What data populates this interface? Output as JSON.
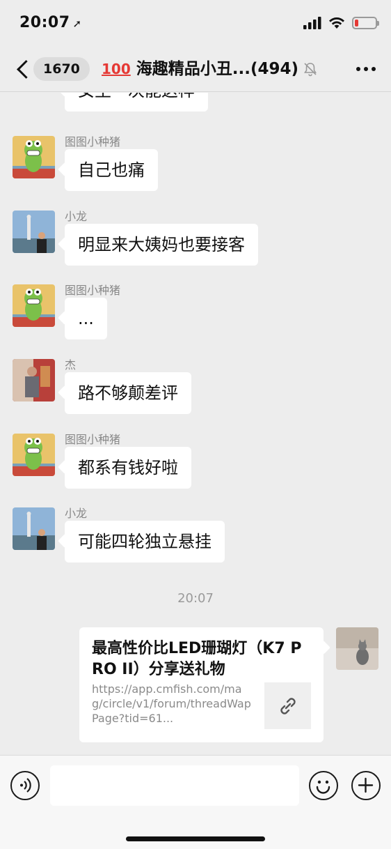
{
  "status_bar": {
    "time": "20:07",
    "location_glyph": "➚"
  },
  "header": {
    "back_count": "1670",
    "title_emoji": "100",
    "title": "海趣精品小丑...",
    "member_count": "(494)"
  },
  "messages": [
    {
      "sender": "",
      "text": "女生一次能这样",
      "avatar": "frog-avatar"
    },
    {
      "sender": "图图小种猪",
      "text": "自己也痛",
      "avatar": "frog-avatar"
    },
    {
      "sender": "小龙",
      "text": "明显来大姨妈也要接客",
      "avatar": "statue-avatar"
    },
    {
      "sender": "图图小种猪",
      "text": "...",
      "avatar": "frog-avatar"
    },
    {
      "sender": "杰",
      "text": "路不够颠差评",
      "avatar": "person-avatar"
    },
    {
      "sender": "图图小种猪",
      "text": "都系有钱好啦",
      "avatar": "frog-avatar"
    },
    {
      "sender": "小龙",
      "text": "可能四轮独立悬挂",
      "avatar": "statue-avatar"
    }
  ],
  "timestamp": "20:07",
  "link_card": {
    "title": "最高性价比LED珊瑚灯（K7 PRO II）分享送礼物",
    "url": "https://app.cmfish.com/mag/circle/v1/forum/threadWapPage?tid=61..."
  },
  "input": {
    "value": "",
    "placeholder": ""
  },
  "colors": {
    "background": "#ededed",
    "bubble": "#ffffff",
    "timestamp": "#9a9a9a",
    "battery_low": "#e53935"
  }
}
